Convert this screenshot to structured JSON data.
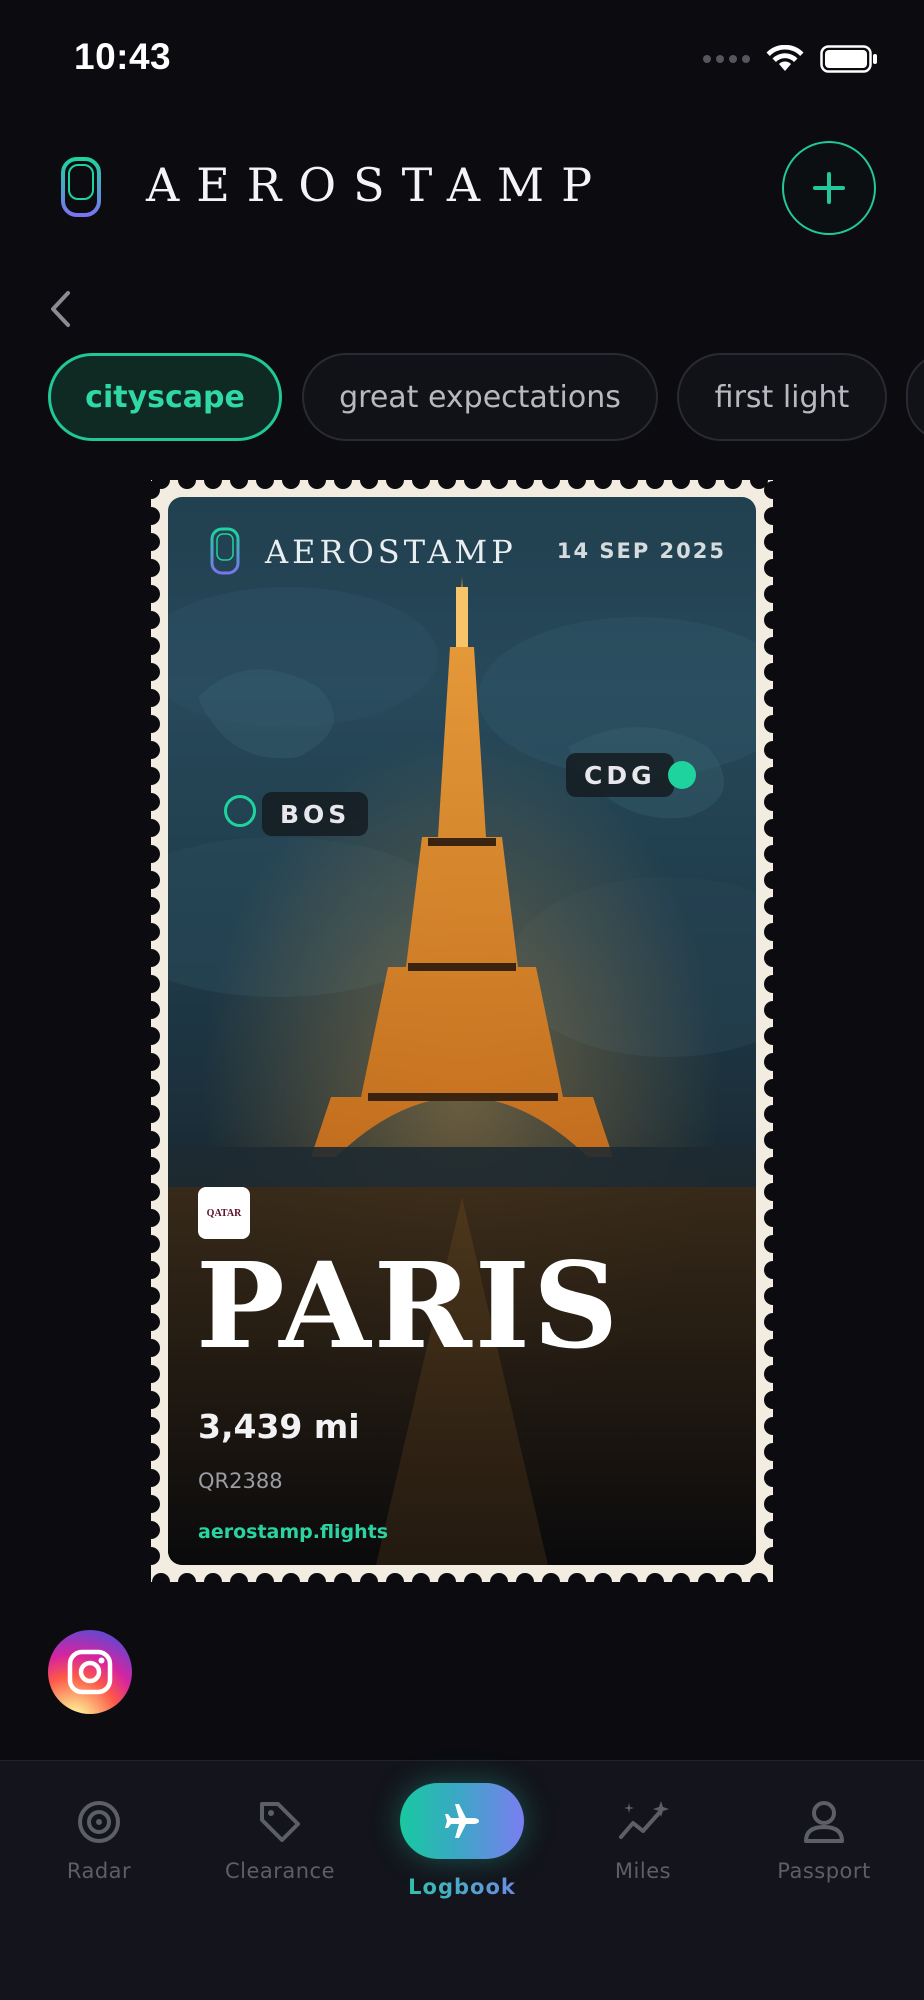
{
  "status_bar": {
    "time": "10:43"
  },
  "header": {
    "title": "AEROSTAMP",
    "add_icon": "plus-icon"
  },
  "filters": {
    "chips": [
      {
        "label": "cityscape",
        "active": true
      },
      {
        "label": "great expectations",
        "active": false
      },
      {
        "label": "first light",
        "active": false
      }
    ]
  },
  "stamp": {
    "brand": "AEROSTAMP",
    "date": "14 SEP 2025",
    "origin": "BOS",
    "destination": "CDG",
    "airline_logo_text": "QATAR",
    "city": "PARIS",
    "distance": "3,439 mi",
    "flight_number": "QR2388",
    "url": "aerostamp.flights"
  },
  "share": {
    "instagram_icon": "instagram-icon"
  },
  "nav": {
    "items": [
      {
        "label": "Radar",
        "icon": "radar-icon"
      },
      {
        "label": "Clearance",
        "icon": "tag-icon"
      },
      {
        "label": "Logbook",
        "icon": "airplane-icon",
        "active": true
      },
      {
        "label": "Miles",
        "icon": "sparkle-chart-icon"
      },
      {
        "label": "Passport",
        "icon": "person-icon"
      }
    ]
  },
  "colors": {
    "accent": "#22c79a",
    "background": "#0b0b10",
    "nav_background": "#13141c"
  }
}
